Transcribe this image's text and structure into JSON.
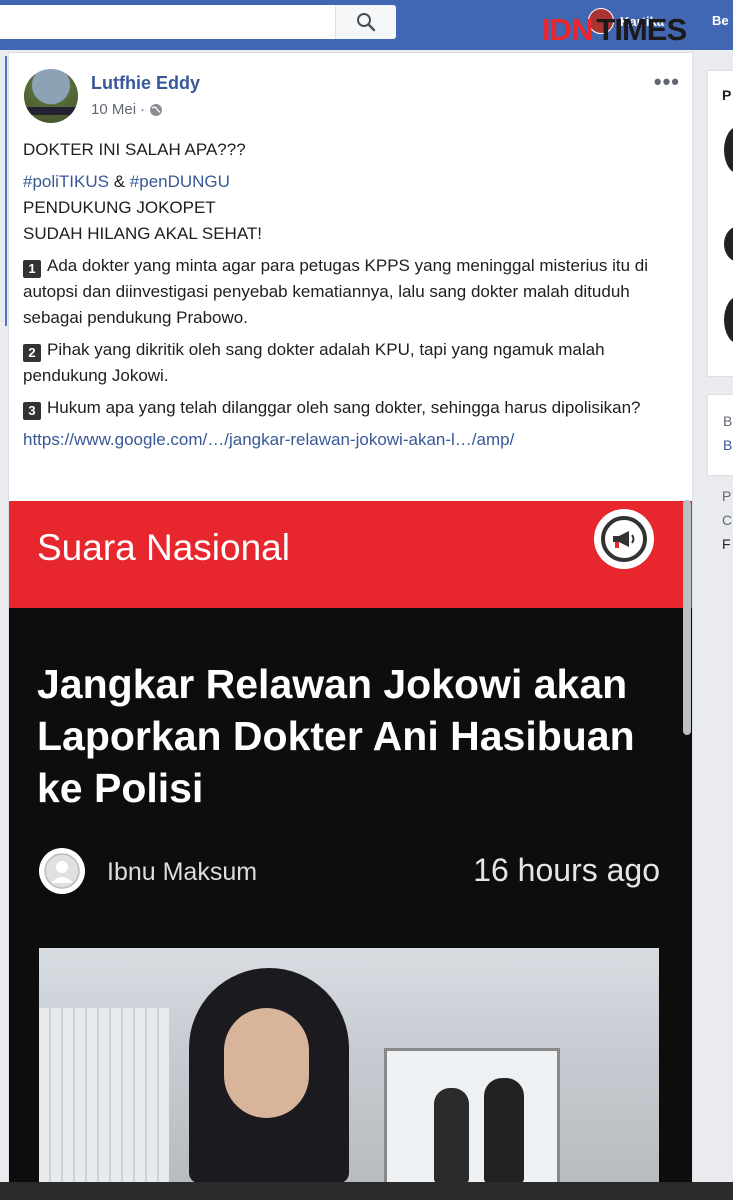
{
  "topbar": {
    "search_placeholder": "",
    "nav_user_name": "Kartika",
    "nav_home_label": "Be"
  },
  "watermark": {
    "part1": "IDN",
    "part2": "TIMES"
  },
  "post": {
    "author": "Lutfhie Eddy",
    "date": "10 Mei",
    "more_label": "•••",
    "line1": "DOKTER INI SALAH APA???",
    "hashtag1": "#poliTIKUS",
    "amp": " & ",
    "hashtag2": "#penDUNGU",
    "line3": "PENDUKUNG JOKOPET",
    "line4": "SUDAH HILANG AKAL SEHAT!",
    "points": [
      {
        "num": "1",
        "text": "Ada dokter yang minta agar para petugas KPPS yang meninggal misterius itu di autopsi dan diinvestigasi penyebab kematiannya, lalu sang dokter malah dituduh sebagai pendukung Prabowo."
      },
      {
        "num": "2",
        "text": "Pihak yang dikritik oleh sang dokter adalah KPU, tapi yang ngamuk malah pendukung Jokowi."
      },
      {
        "num": "3",
        "text": "Hukum apa yang telah dilanggar oleh sang dokter, sehingga harus dipolisikan?"
      }
    ],
    "link": "https://www.google.com/…/jangkar-relawan-jokowi-akan-l…/amp/"
  },
  "article": {
    "site_name": "Suara Nasional",
    "headline": "Jangkar Relawan Jokowi akan Laporkan Dokter Ani Hasibuan ke Polisi",
    "author": "Ibnu Maksum",
    "time": "16 hours ago"
  },
  "right": {
    "card1_letter": "P",
    "card2_line1": "B",
    "card2_line2": "B",
    "card3_line1": "P",
    "card3_line2": "C",
    "card3_line3": "F"
  },
  "colors": {
    "facebook_blue": "#4267b2",
    "link_blue": "#385898",
    "article_red": "#e8262d"
  }
}
